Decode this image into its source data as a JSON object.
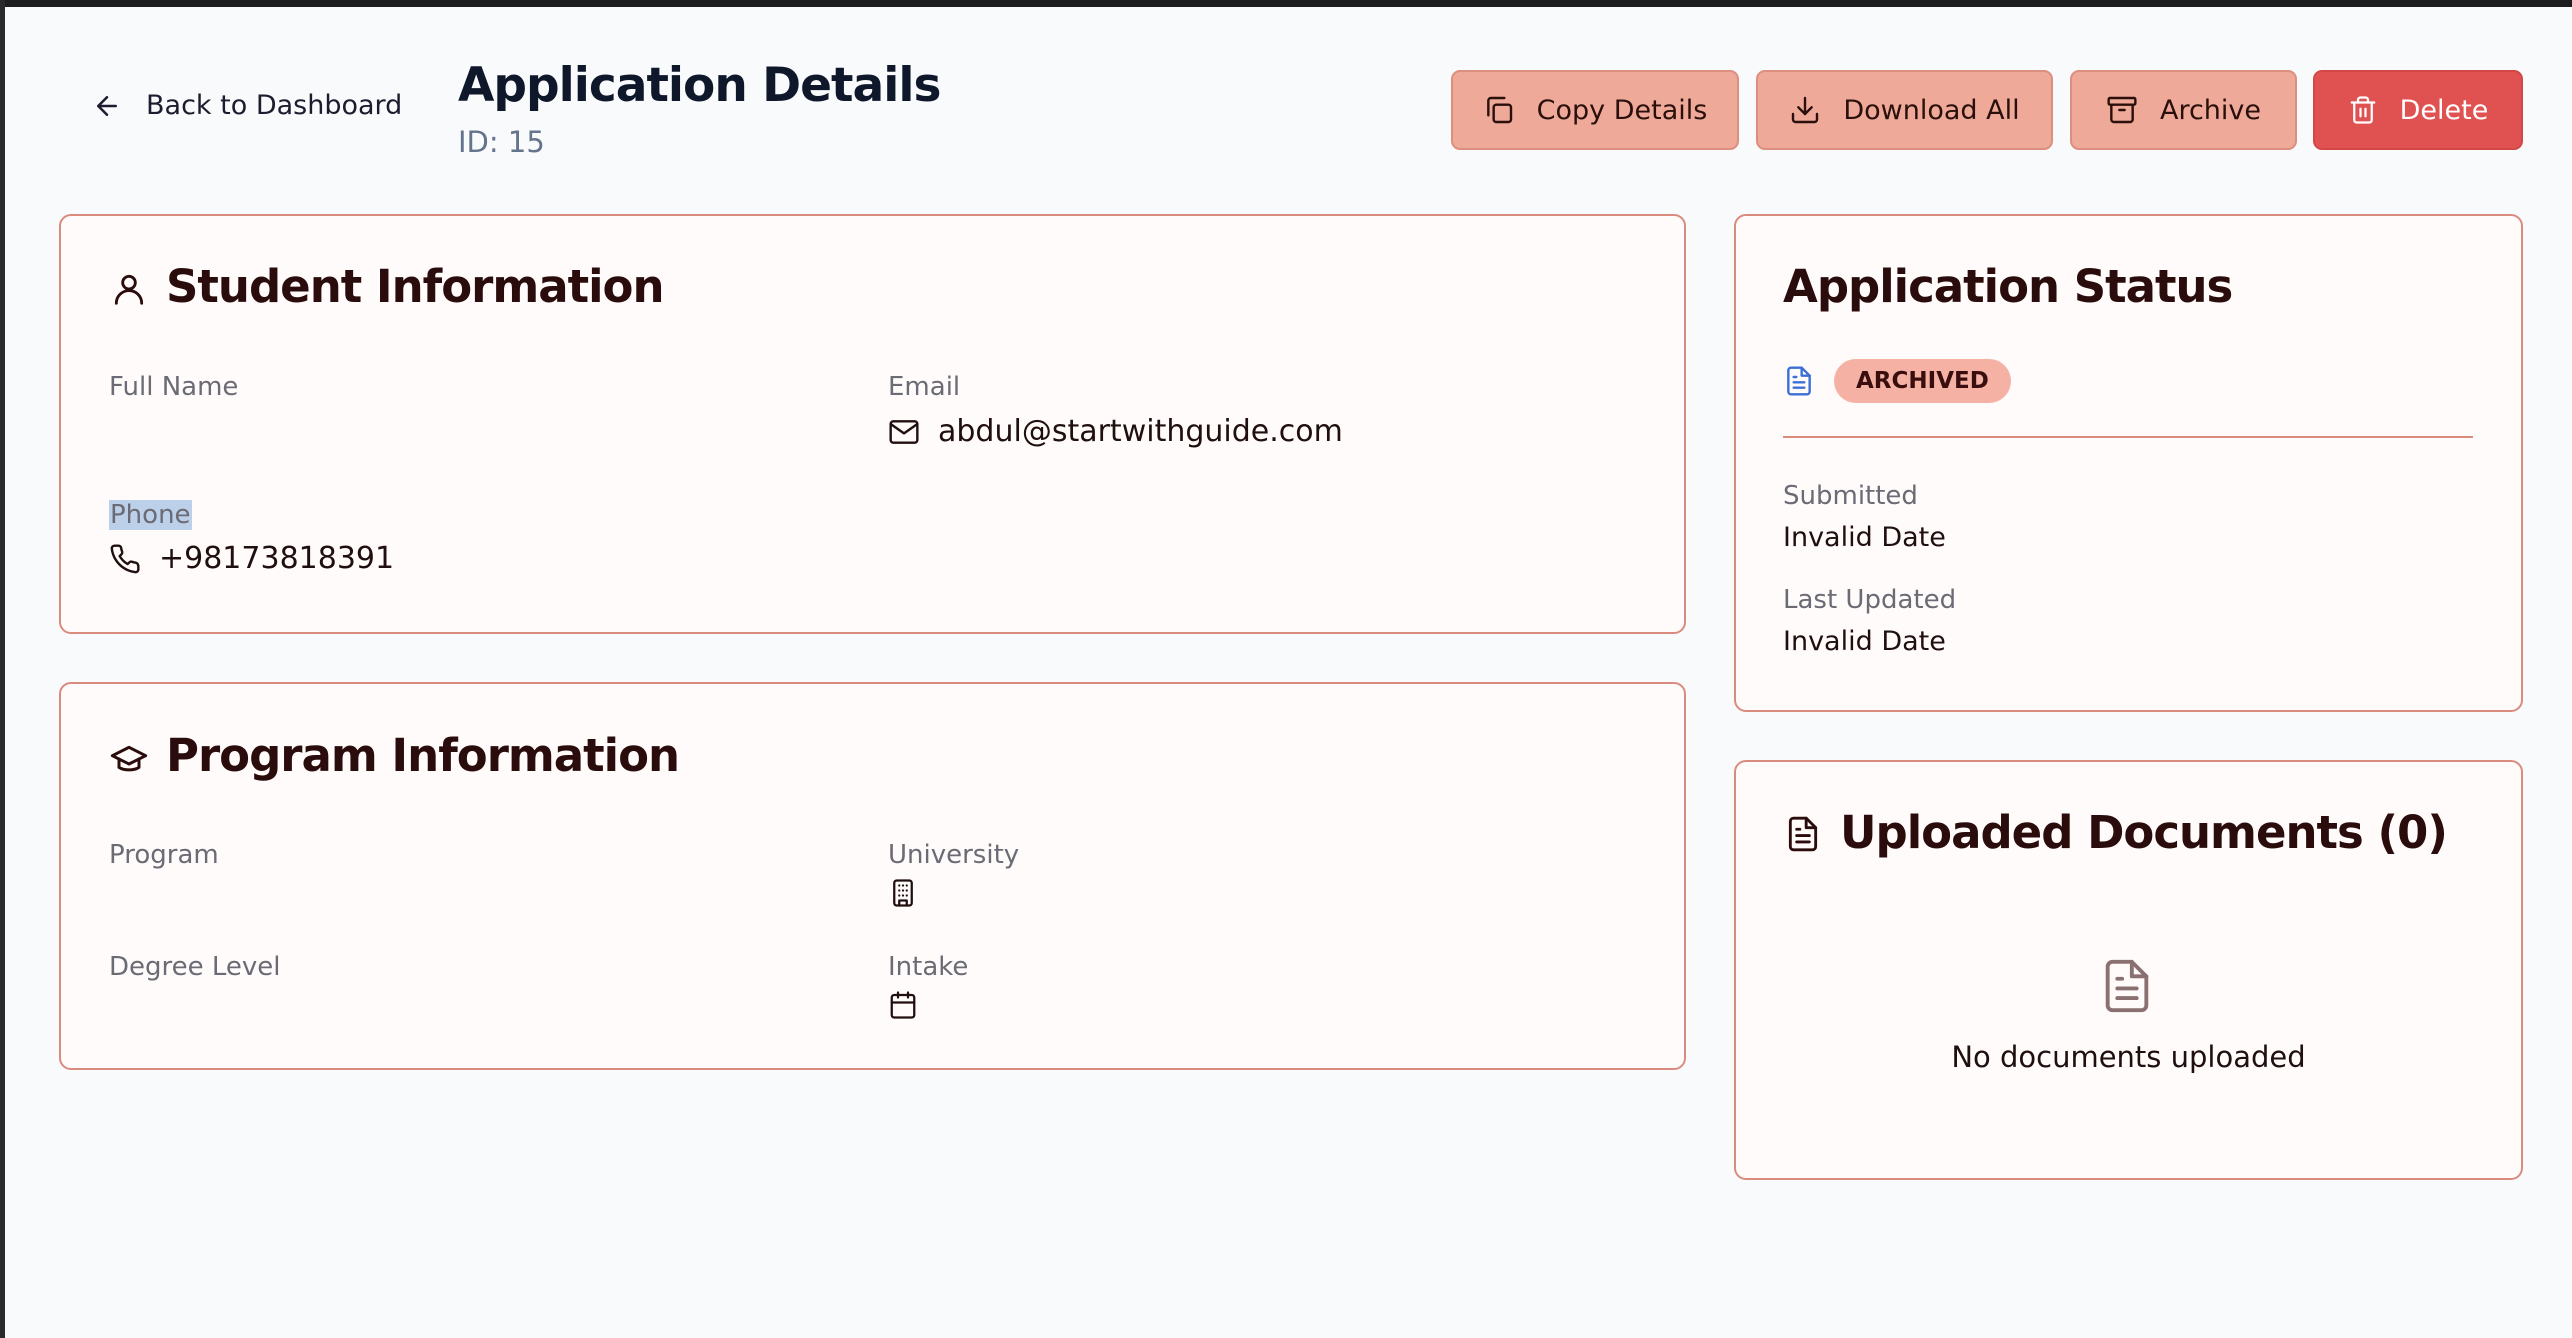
{
  "header": {
    "back_label": "Back to Dashboard",
    "title": "Application Details",
    "id_text": "ID: 15"
  },
  "actions": {
    "copy_label": "Copy Details",
    "download_label": "Download All",
    "archive_label": "Archive",
    "delete_label": "Delete"
  },
  "student": {
    "title": "Student Information",
    "full_name_label": "Full Name",
    "full_name_value": "",
    "email_label": "Email",
    "email_value": "abdul@startwithguide.com",
    "phone_label": "Phone",
    "phone_value": "+98173818391"
  },
  "program": {
    "title": "Program Information",
    "program_label": "Program",
    "university_label": "University",
    "degree_label": "Degree Level",
    "intake_label": "Intake"
  },
  "status": {
    "title": "Application Status",
    "badge": "ARCHIVED",
    "submitted_label": "Submitted",
    "submitted_value": "Invalid Date",
    "updated_label": "Last Updated",
    "updated_value": "Invalid Date"
  },
  "documents": {
    "title": "Uploaded Documents (0)",
    "empty_text": "No documents uploaded"
  },
  "colors": {
    "accent_soft": "#eea999",
    "danger": "#e05251",
    "card_border": "#d98c7e",
    "badge_bg": "#f5b2a4"
  },
  "icons": [
    "arrow-left-icon",
    "copy-icon",
    "download-icon",
    "archive-icon",
    "trash-icon",
    "user-icon",
    "mail-icon",
    "phone-icon",
    "graduation-cap-icon",
    "building-icon",
    "calendar-icon",
    "file-text-icon"
  ]
}
